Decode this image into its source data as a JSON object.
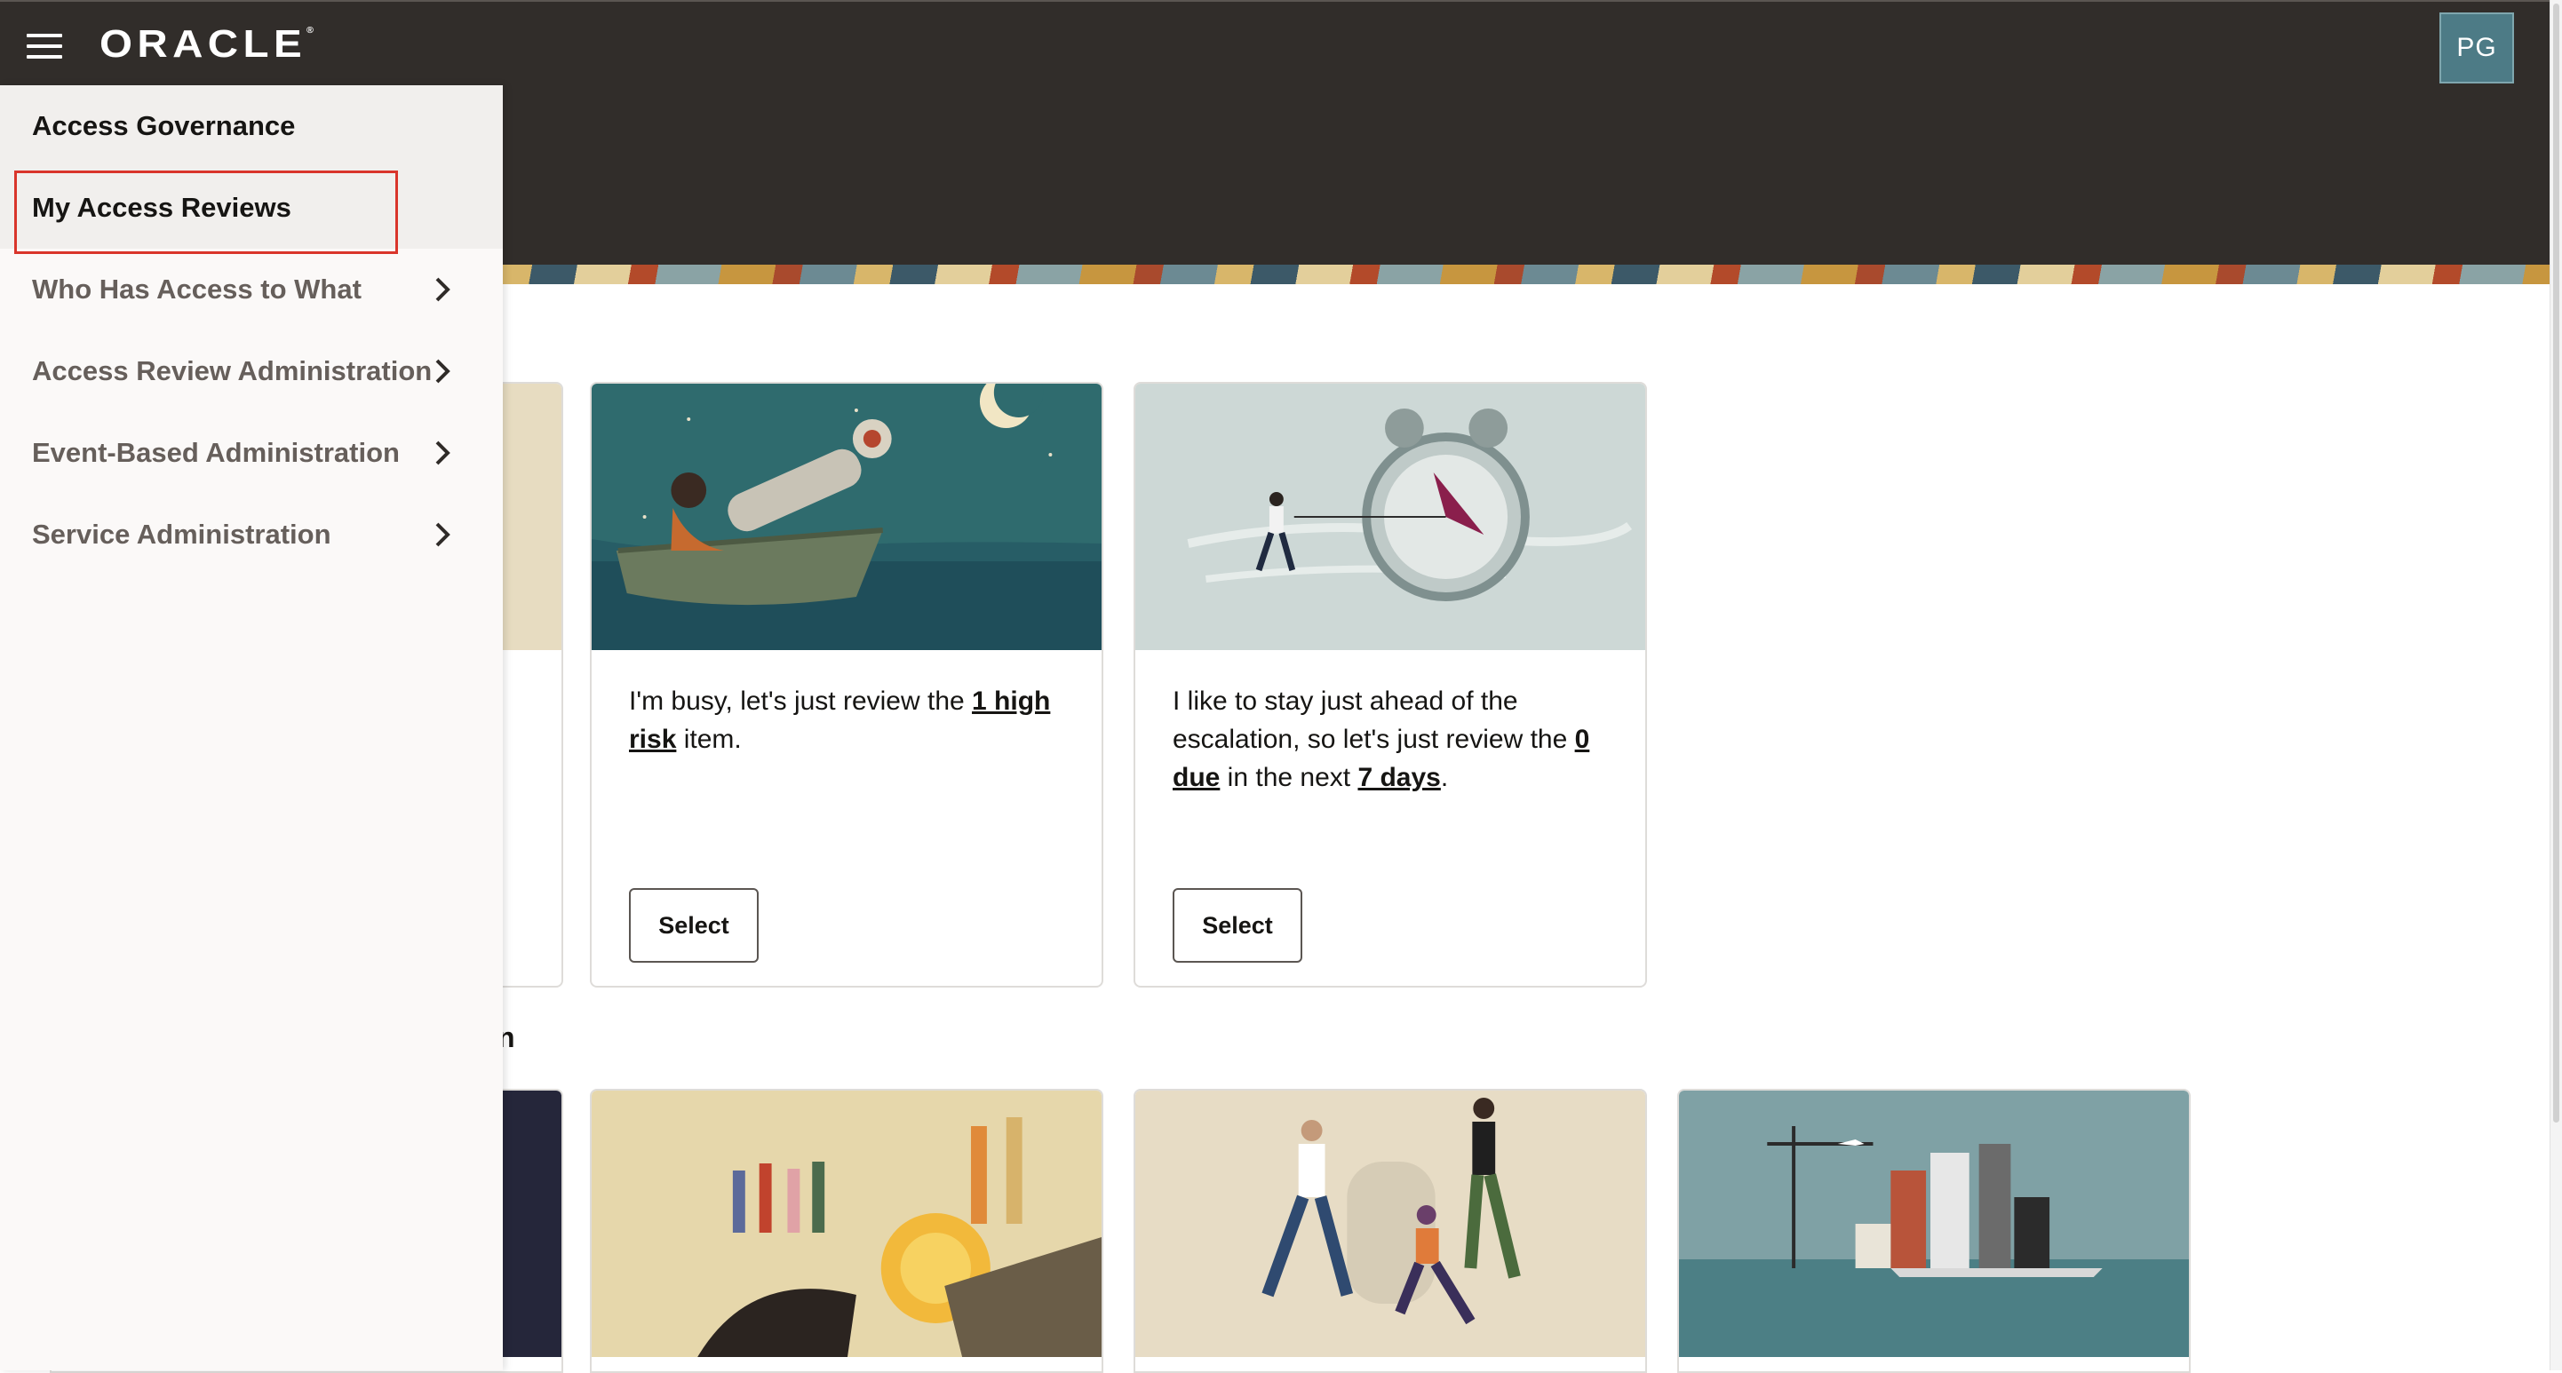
{
  "header": {
    "brand": "ORACLE",
    "brand_mark": "®",
    "avatar_initials": "PG"
  },
  "nav": {
    "section_title": "Access Governance",
    "items": [
      {
        "label": "My Access Reviews",
        "active": true,
        "has_children": false
      },
      {
        "label": "Who Has Access to What",
        "active": false,
        "has_children": true
      },
      {
        "label": "Access Review Administration",
        "active": false,
        "has_children": true
      },
      {
        "label": "Event-Based Administration",
        "active": false,
        "has_children": true
      },
      {
        "label": "Service Administration",
        "active": false,
        "has_children": true
      }
    ]
  },
  "cards": [
    {
      "text_parts": [
        "I'm busy, let's just review the ",
        "1 high risk",
        " item."
      ],
      "button_label": "Select"
    },
    {
      "text_parts": [
        "I like to stay just ahead of the escalation, so let's just review the ",
        "0 due",
        " in the next ",
        "7 days",
        "."
      ],
      "button_label": "Select"
    }
  ],
  "section_fragment": "n",
  "colors": {
    "topbar": "#312d2a",
    "drawer": "#fbf9f8",
    "active_item": "#f1efed",
    "highlight": "#d9352b",
    "avatar": "#4d7b86"
  },
  "icons": {
    "menu": "hamburger-icon",
    "chevron": "chevron-right-icon"
  }
}
